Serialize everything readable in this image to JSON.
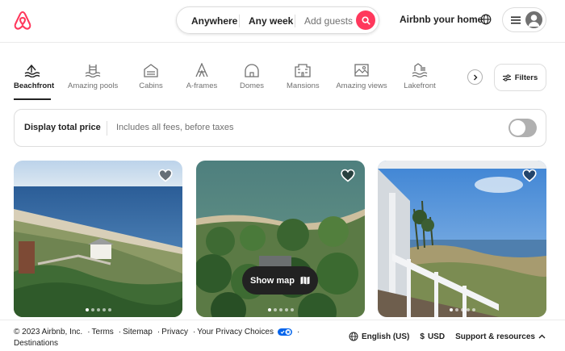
{
  "brand": {
    "logo_icon": "airbnb-logo-icon",
    "accent": "#ff385c"
  },
  "search": {
    "where": "Anywhere",
    "when": "Any week",
    "who": "Add guests",
    "button_icon": "search-icon"
  },
  "header": {
    "host_label": "Airbnb your home",
    "globe_icon": "globe-icon",
    "menu_icon": "hamburger-icon",
    "avatar_icon": "user-avatar-icon"
  },
  "categories": [
    {
      "label": "Beachfront",
      "icon": "beachfront-icon",
      "active": true
    },
    {
      "label": "Amazing pools",
      "icon": "pool-icon",
      "active": false
    },
    {
      "label": "Cabins",
      "icon": "cabin-icon",
      "active": false
    },
    {
      "label": "A-frames",
      "icon": "a-frame-icon",
      "active": false
    },
    {
      "label": "Domes",
      "icon": "dome-icon",
      "active": false
    },
    {
      "label": "Mansions",
      "icon": "mansion-icon",
      "active": false
    },
    {
      "label": "Amazing views",
      "icon": "view-icon",
      "active": false
    },
    {
      "label": "Lakefront",
      "icon": "lakefront-icon",
      "active": false
    }
  ],
  "filters": {
    "label": "Filters",
    "icon": "filters-icon",
    "next_icon": "chevron-right-icon"
  },
  "price_display": {
    "title": "Display total price",
    "subtitle": "Includes all fees, before taxes",
    "toggle_on": false
  },
  "listings": [
    {
      "favorite_icon": "heart-icon",
      "photo": "aerial beach with house",
      "photo_index": 1,
      "photo_count": 5
    },
    {
      "favorite_icon": "heart-icon",
      "photo": "aerial wooded shoreline",
      "photo_index": 1,
      "photo_count": 5
    },
    {
      "favorite_icon": "heart-icon",
      "photo": "porch view of bay",
      "photo_index": 1,
      "photo_count": 5
    }
  ],
  "map_button": {
    "label": "Show map",
    "icon": "map-icon"
  },
  "footer": {
    "copyright": "© 2023 Airbnb, Inc.",
    "links": [
      "Terms",
      "Sitemap",
      "Privacy",
      "Your Privacy Choices",
      "Destinations"
    ],
    "language": "English (US)",
    "currency_symbol": "$",
    "currency": "USD",
    "support": "Support & resources"
  }
}
